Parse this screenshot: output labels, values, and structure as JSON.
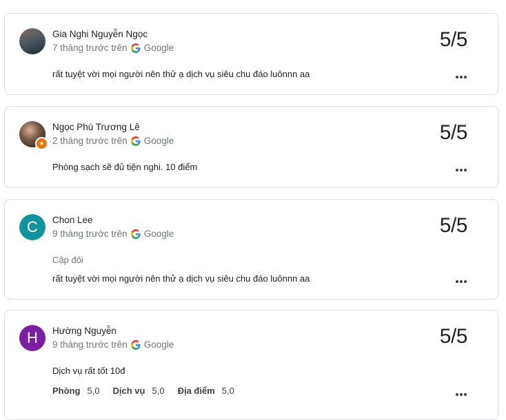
{
  "reviews": [
    {
      "name": "Gia Nghi Nguyễn Ngọc",
      "time": "7 tháng trước trên",
      "source": "Google",
      "score": "5/5",
      "text": "rất tuyệt vời mọi người nên thử ạ dịch vụ siêu chu đáo luônnn aa",
      "avatar": "photo"
    },
    {
      "name": "Ngọc Phú Trương Lê",
      "time": "2 tháng trước trên",
      "source": "Google",
      "score": "5/5",
      "text": "Phòng sạch sẽ đủ tiện nghi. 10 điểm",
      "avatar": "photo",
      "badge": "local-guide-star"
    },
    {
      "name": "Chon Lee",
      "time": "9 tháng trước trên",
      "source": "Google",
      "score": "5/5",
      "trip_type": "Cặp đôi",
      "text": "rất tuyệt vời mọi người nên thử ạ dịch vụ siêu chu đáo luônnn aa",
      "avatar_letter": "C",
      "avatar_color": "#12949d"
    },
    {
      "name": "Hường Nguyễn",
      "time": "9 tháng trước trên",
      "source": "Google",
      "score": "5/5",
      "text": "Dịch vụ rất tốt 10đ",
      "avatar_letter": "H",
      "avatar_color": "#7b1fa2",
      "sub_ratings": [
        {
          "label": "Phòng",
          "value": "5,0"
        },
        {
          "label": "Dịch vụ",
          "value": "5,0"
        },
        {
          "label": "Địa điểm",
          "value": "5,0"
        }
      ]
    }
  ],
  "icons": {
    "source_logo": "google-g-icon",
    "menu": "more-horiz-icon",
    "badge": "star-icon"
  },
  "colors": {
    "text_primary": "#202124",
    "text_secondary": "#70757a",
    "border": "#dadce0"
  }
}
